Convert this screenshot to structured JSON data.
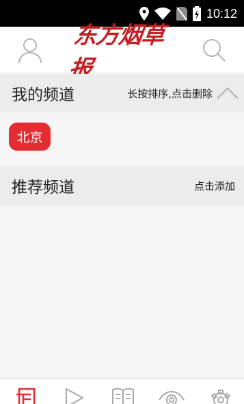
{
  "status_bar": {
    "time": "10:12",
    "icons": [
      "location-icon",
      "wifi-icon",
      "no-sim-icon",
      "battery-charging-icon"
    ]
  },
  "app_bar": {
    "logo_text": "东方烟草报",
    "left_icon": "user-icon",
    "right_icon": "search-icon"
  },
  "my_channels": {
    "title": "我的频道",
    "hint": "长按排序,点击删除",
    "collapse_icon": "chevron-up-icon",
    "items": [
      {
        "label": "北京"
      }
    ]
  },
  "recommended_channels": {
    "title": "推荐频道",
    "hint": "点击添加"
  },
  "tab_bar": {
    "icons": [
      "news-icon",
      "play-icon",
      "book-icon",
      "eye-icon",
      "gear-icon"
    ],
    "active_color": "#e32d33"
  }
}
